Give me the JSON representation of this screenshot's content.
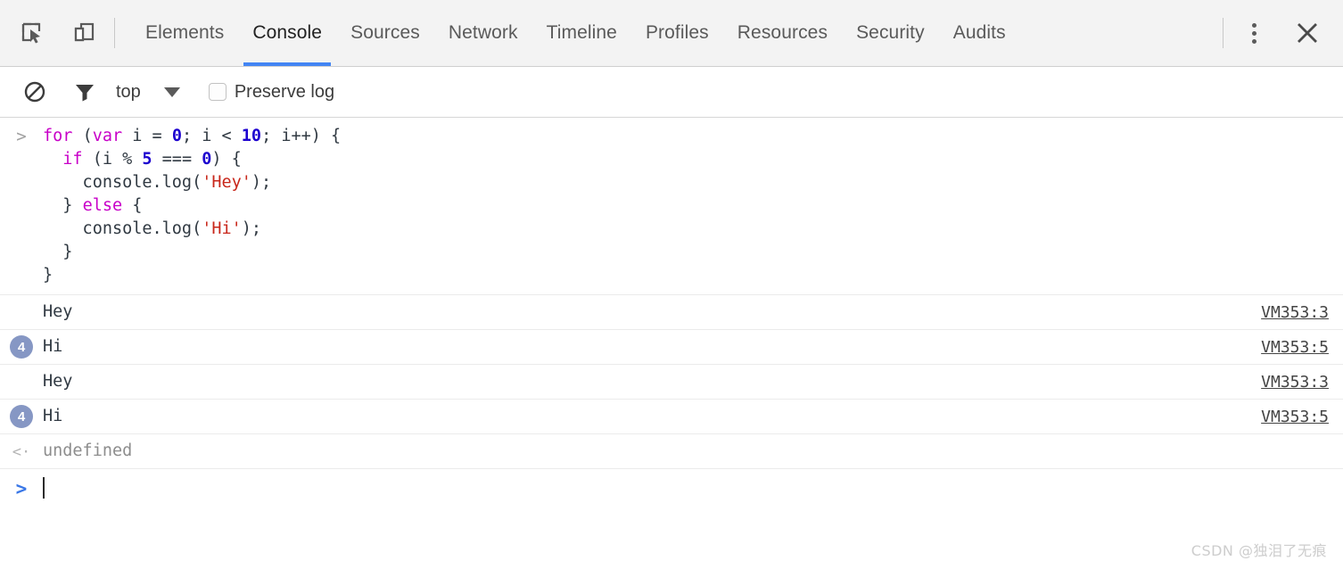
{
  "tabbar": {
    "left_icons": [
      {
        "name": "inspect-element-icon",
        "title": "Inspect element"
      },
      {
        "name": "device-toolbar-icon",
        "title": "Toggle device toolbar"
      }
    ],
    "tabs": [
      {
        "label": "Elements",
        "active": false
      },
      {
        "label": "Console",
        "active": true
      },
      {
        "label": "Sources",
        "active": false
      },
      {
        "label": "Network",
        "active": false
      },
      {
        "label": "Timeline",
        "active": false
      },
      {
        "label": "Profiles",
        "active": false
      },
      {
        "label": "Resources",
        "active": false
      },
      {
        "label": "Security",
        "active": false
      },
      {
        "label": "Audits",
        "active": false
      }
    ],
    "more_menu": "more-vertical-icon",
    "close": "close-icon",
    "active_accent": "#4285f4"
  },
  "filterbar": {
    "clear_icon": "clear-console-icon",
    "filter_icon": "filter-icon",
    "context": "top",
    "context_arrow": "chevron-down-icon",
    "preserve_log_label": "Preserve log",
    "preserve_log_checked": false
  },
  "console": {
    "prompt_marker": ">",
    "result_marker": "<·",
    "input_lines": [
      [
        {
          "t": "for ",
          "c": "k"
        },
        {
          "t": "(",
          "c": ""
        },
        {
          "t": "var",
          "c": "k"
        },
        {
          "t": " i = ",
          "c": ""
        },
        {
          "t": "0",
          "c": "n"
        },
        {
          "t": "; i < ",
          "c": ""
        },
        {
          "t": "10",
          "c": "n"
        },
        {
          "t": "; i++) {",
          "c": ""
        }
      ],
      [
        {
          "t": "  ",
          "c": ""
        },
        {
          "t": "if",
          "c": "k"
        },
        {
          "t": " (i % ",
          "c": ""
        },
        {
          "t": "5",
          "c": "n"
        },
        {
          "t": " === ",
          "c": ""
        },
        {
          "t": "0",
          "c": "n"
        },
        {
          "t": ") {",
          "c": ""
        }
      ],
      [
        {
          "t": "    console.log(",
          "c": ""
        },
        {
          "t": "'Hey'",
          "c": "s"
        },
        {
          "t": ");",
          "c": ""
        }
      ],
      [
        {
          "t": "  } ",
          "c": ""
        },
        {
          "t": "else",
          "c": "k"
        },
        {
          "t": " {",
          "c": ""
        }
      ],
      [
        {
          "t": "    console.log(",
          "c": ""
        },
        {
          "t": "'Hi'",
          "c": "s"
        },
        {
          "t": ");",
          "c": ""
        }
      ],
      [
        {
          "t": "  }",
          "c": ""
        }
      ],
      [
        {
          "t": "}",
          "c": ""
        }
      ]
    ],
    "log_rows": [
      {
        "badge": null,
        "text": "Hey",
        "source": "VM353:3"
      },
      {
        "badge": "4",
        "text": "Hi",
        "source": "VM353:5"
      },
      {
        "badge": null,
        "text": "Hey",
        "source": "VM353:3"
      },
      {
        "badge": "4",
        "text": "Hi",
        "source": "VM353:5"
      }
    ],
    "result": "undefined",
    "prompt_value": "",
    "badge_color": "#8697c4",
    "string_color": "#c8261a",
    "keyword_color": "#c800c8",
    "number_color": "#1c00cf"
  },
  "watermark": {
    "text": "CSDN @独泪了无痕"
  }
}
